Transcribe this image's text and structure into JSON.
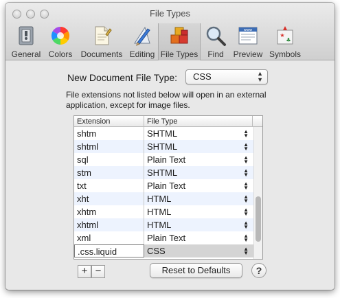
{
  "window": {
    "title": "File Types"
  },
  "toolbar": {
    "items": [
      {
        "label": "General",
        "icon": "switch-panel-icon"
      },
      {
        "label": "Colors",
        "icon": "color-wheel-icon"
      },
      {
        "label": "Documents",
        "icon": "document-icon"
      },
      {
        "label": "Editing",
        "icon": "pencil-ruler-icon"
      },
      {
        "label": "File Types",
        "icon": "colored-blocks-icon",
        "selected": true
      },
      {
        "label": "Find",
        "icon": "magnifier-icon"
      },
      {
        "label": "Preview",
        "icon": "web-preview-icon"
      },
      {
        "label": "Symbols",
        "icon": "symbols-icon"
      }
    ]
  },
  "new_doc": {
    "label": "New Document File Type:",
    "value": "CSS"
  },
  "info_text": "File extensions not listed below will open in an external application, except for image files.",
  "table": {
    "headers": [
      "Extension",
      "File Type"
    ],
    "rows": [
      {
        "ext": "shtm",
        "type": "SHTML"
      },
      {
        "ext": "shtml",
        "type": "SHTML"
      },
      {
        "ext": "sql",
        "type": "Plain Text"
      },
      {
        "ext": "stm",
        "type": "SHTML"
      },
      {
        "ext": "txt",
        "type": "Plain Text"
      },
      {
        "ext": "xht",
        "type": "HTML"
      },
      {
        "ext": "xhtm",
        "type": "HTML"
      },
      {
        "ext": "xhtml",
        "type": "HTML"
      },
      {
        "ext": "xml",
        "type": "Plain Text"
      },
      {
        "ext": ".css.liquid",
        "type": "CSS",
        "editing": true
      }
    ],
    "scroll_position": 0.82
  },
  "buttons": {
    "add": "+",
    "remove": "−",
    "reset": "Reset to Defaults",
    "help": "?"
  }
}
